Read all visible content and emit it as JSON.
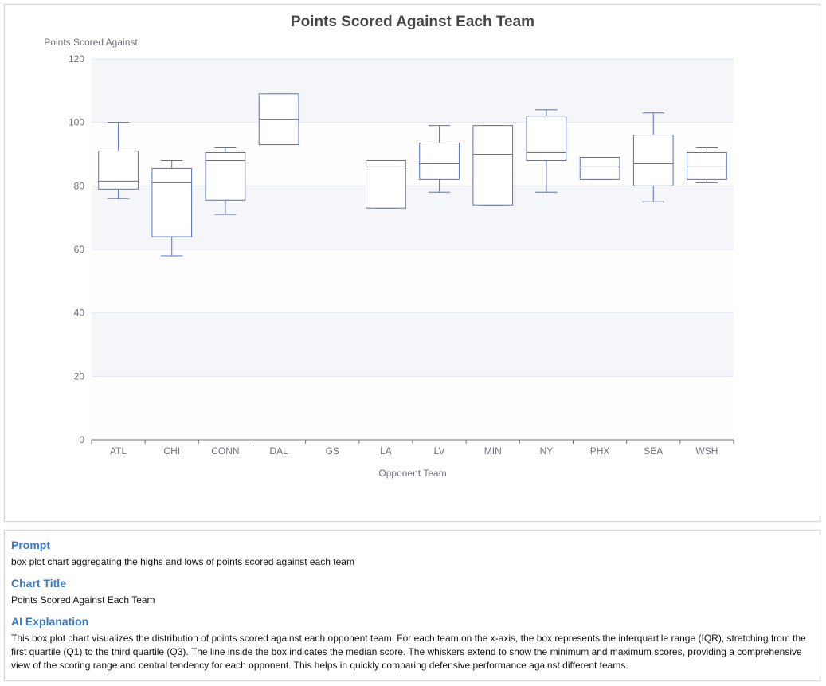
{
  "chart_data": {
    "type": "boxplot",
    "title": "Points Scored Against Each Team",
    "xlabel": "Opponent Team",
    "ylabel": "Points Scored Against",
    "ylim": [
      0,
      120
    ],
    "yticks": [
      0,
      20,
      40,
      60,
      80,
      100,
      120
    ],
    "grid": true,
    "categories": [
      "ATL",
      "CHI",
      "CONN",
      "DAL",
      "GS",
      "LA",
      "LV",
      "MIN",
      "NY",
      "PHX",
      "SEA",
      "WSH"
    ],
    "boxes": [
      {
        "category": "ATL",
        "min": 76,
        "q1": 79,
        "median": 81.5,
        "q3": 91,
        "max": 100
      },
      {
        "category": "CHI",
        "min": 58,
        "q1": 64,
        "median": 81,
        "q3": 85.5,
        "max": 88
      },
      {
        "category": "CONN",
        "min": 71,
        "q1": 75.5,
        "median": 88,
        "q3": 90.5,
        "max": 92
      },
      {
        "category": "DAL",
        "min": 93,
        "q1": 93,
        "median": 101,
        "q3": 109,
        "max": 109
      },
      {
        "category": "GS",
        "min": null,
        "q1": null,
        "median": null,
        "q3": null,
        "max": null
      },
      {
        "category": "LA",
        "min": 73,
        "q1": 73,
        "median": 86,
        "q3": 88,
        "max": 88
      },
      {
        "category": "LV",
        "min": 78,
        "q1": 82,
        "median": 87,
        "q3": 93.5,
        "max": 99
      },
      {
        "category": "MIN",
        "min": 74,
        "q1": 74,
        "median": 90,
        "q3": 99,
        "max": 99
      },
      {
        "category": "NY",
        "min": 78,
        "q1": 88,
        "median": 90.5,
        "q3": 102,
        "max": 104
      },
      {
        "category": "PHX",
        "min": 82,
        "q1": 82,
        "median": 86,
        "q3": 89,
        "max": 89
      },
      {
        "category": "SEA",
        "min": 75,
        "q1": 80,
        "median": 87,
        "q3": 96,
        "max": 103
      },
      {
        "category": "WSH",
        "min": 81,
        "q1": 82,
        "median": 86,
        "q3": 90.5,
        "max": 92
      }
    ],
    "colors": {
      "box": "#5470c6",
      "band": "#f5f6fa",
      "grid": "#e0e6f1",
      "axis": "#6e7079",
      "title": "#464646"
    }
  },
  "info": {
    "prompt_heading": "Prompt",
    "prompt_text": "box plot chart aggregating the highs and lows of points scored against each team",
    "title_heading": "Chart Title",
    "title_text": "Points Scored Against Each Team",
    "explanation_heading": "AI Explanation",
    "explanation_text": "This box plot chart visualizes the distribution of points scored against each opponent team. For each team on the x-axis, the box represents the interquartile range (IQR), stretching from the first quartile (Q1) to the third quartile (Q3). The line inside the box indicates the median score. The whiskers extend to show the minimum and maximum scores, providing a comprehensive view of the scoring range and central tendency for each opponent. This helps in quickly comparing defensive performance against different teams."
  }
}
